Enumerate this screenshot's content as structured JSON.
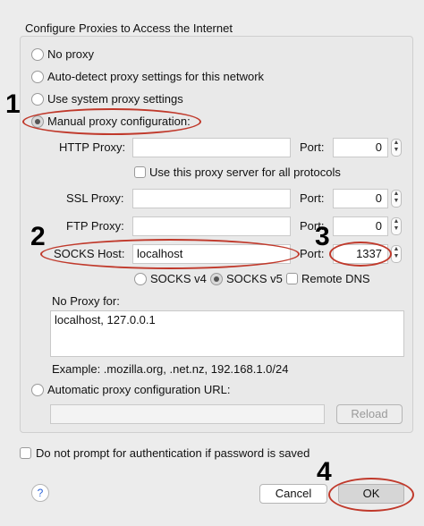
{
  "title": "Configure Proxies to Access the Internet",
  "options": {
    "no_proxy": "No proxy",
    "auto_detect": "Auto-detect proxy settings for this network",
    "system": "Use system proxy settings",
    "manual": "Manual proxy configuration:",
    "auto_config": "Automatic proxy configuration URL:"
  },
  "labels": {
    "http": "HTTP Proxy:",
    "ssl": "SSL Proxy:",
    "ftp": "FTP Proxy:",
    "socks": "SOCKS Host:",
    "port": "Port:",
    "all_protocols": "Use this proxy server for all protocols",
    "socks_v4": "SOCKS v4",
    "socks_v5": "SOCKS v5",
    "remote_dns": "Remote DNS",
    "no_proxy_for": "No Proxy for:",
    "example": "Example: .mozilla.org, .net.nz, 192.168.1.0/24",
    "no_prompt": "Do not prompt for authentication if password is saved"
  },
  "values": {
    "http_host": "",
    "http_port": "0",
    "ssl_host": "",
    "ssl_port": "0",
    "ftp_host": "",
    "ftp_port": "0",
    "socks_host": "localhost",
    "socks_port": "1337",
    "no_proxy_list": "localhost, 127.0.0.1",
    "auto_config_url": ""
  },
  "buttons": {
    "reload": "Reload",
    "cancel": "Cancel",
    "ok": "OK",
    "help": "?"
  },
  "annotations": [
    "1",
    "2",
    "3",
    "4"
  ],
  "colors": {
    "annotation_ellipse": "#c0392b",
    "help_icon": "#2a62d8"
  }
}
